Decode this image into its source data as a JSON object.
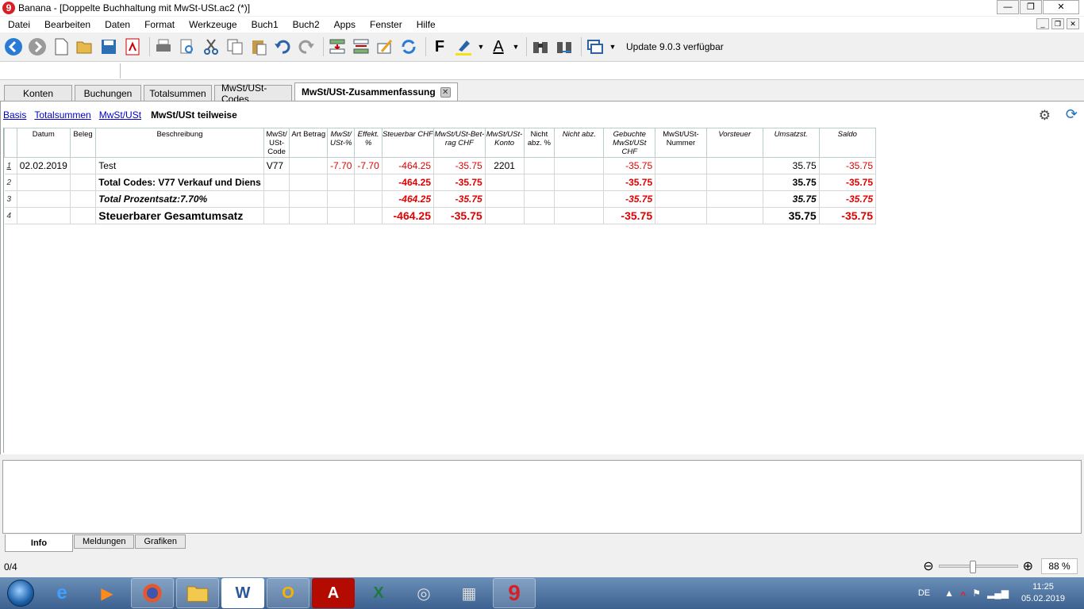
{
  "window": {
    "title": "Banana - [Doppelte Buchhaltung mit MwSt-USt.ac2 (*)]",
    "app_icon": "9"
  },
  "menu": [
    "Datei",
    "Bearbeiten",
    "Daten",
    "Format",
    "Werkzeuge",
    "Buch1",
    "Buch2",
    "Apps",
    "Fenster",
    "Hilfe"
  ],
  "toolbar": {
    "update_text": "Update 9.0.3 verfügbar",
    "bold_label": "F",
    "font_color_label": "A"
  },
  "tabs": [
    "Konten",
    "Buchungen",
    "Totalsummen",
    "MwSt/USt-Codes",
    "MwSt/USt-Zusammenfassung"
  ],
  "views": {
    "links": [
      "Basis",
      "Totalsummen",
      "MwSt/USt"
    ],
    "current": "MwSt/USt teilweise"
  },
  "table": {
    "headers": {
      "datum": "Datum",
      "beleg": "Beleg",
      "beschreibung": "Beschreibung",
      "code": "MwSt/ USt- Code",
      "art": "Art Betrag",
      "ust_pct": "MwSt/ USt-%",
      "effekt": "Effekt. %",
      "steuerbar": "Steuerbar CHF",
      "betrag": "MwSt/USt-Bet- rag CHF",
      "konto": "MwSt/USt- Konto",
      "nicht_pct": "Nicht abz. %",
      "nicht_abz": "Nicht abz.",
      "gebucht": "Gebuchte MwSt/USt CHF",
      "nummer": "MwSt/USt- Nummer",
      "vorsteuer": "Vorsteuer",
      "umsatz": "Umsatzst.",
      "saldo": "Saldo"
    },
    "rows": [
      {
        "nr": "1",
        "datum": "02.02.2019",
        "beleg": "",
        "beschreibung": "Test",
        "code": "V77",
        "art": "",
        "ust_pct": "-7.70",
        "effekt": "-7.70",
        "steuerbar": "-464.25",
        "betrag": "-35.75",
        "konto": "2201",
        "nicht_pct": "",
        "nicht_abz": "",
        "gebucht": "-35.75",
        "nummer": "",
        "vorsteuer": "",
        "umsatz": "35.75",
        "saldo": "-35.75"
      },
      {
        "nr": "2",
        "datum": "",
        "beleg": "",
        "beschreibung": "Total Codes: V77 Verkauf und Diens",
        "code": "",
        "art": "",
        "ust_pct": "",
        "effekt": "",
        "steuerbar": "-464.25",
        "betrag": "-35.75",
        "konto": "",
        "nicht_pct": "",
        "nicht_abz": "",
        "gebucht": "-35.75",
        "nummer": "",
        "vorsteuer": "",
        "umsatz": "35.75",
        "saldo": "-35.75"
      },
      {
        "nr": "3",
        "datum": "",
        "beleg": "",
        "beschreibung": "Total Prozentsatz:7.70%",
        "code": "",
        "art": "",
        "ust_pct": "",
        "effekt": "",
        "steuerbar": "-464.25",
        "betrag": "-35.75",
        "konto": "",
        "nicht_pct": "",
        "nicht_abz": "",
        "gebucht": "-35.75",
        "nummer": "",
        "vorsteuer": "",
        "umsatz": "35.75",
        "saldo": "-35.75"
      },
      {
        "nr": "4",
        "datum": "",
        "beleg": "",
        "beschreibung": "Steuerbarer Gesamtumsatz",
        "code": "",
        "art": "",
        "ust_pct": "",
        "effekt": "",
        "steuerbar": "-464.25",
        "betrag": "-35.75",
        "konto": "",
        "nicht_pct": "",
        "nicht_abz": "",
        "gebucht": "-35.75",
        "nummer": "",
        "vorsteuer": "",
        "umsatz": "35.75",
        "saldo": "-35.75"
      }
    ]
  },
  "bottom_tabs": [
    "Info",
    "Meldungen",
    "Grafiken"
  ],
  "status": {
    "position": "0/4",
    "zoom": "88 %"
  },
  "taskbar": {
    "language": "DE",
    "time": "11:25",
    "date": "05.02.2019"
  },
  "colors": {
    "negative": "#e00000",
    "link": "#0000cc",
    "accent": "#1a6fbf"
  }
}
